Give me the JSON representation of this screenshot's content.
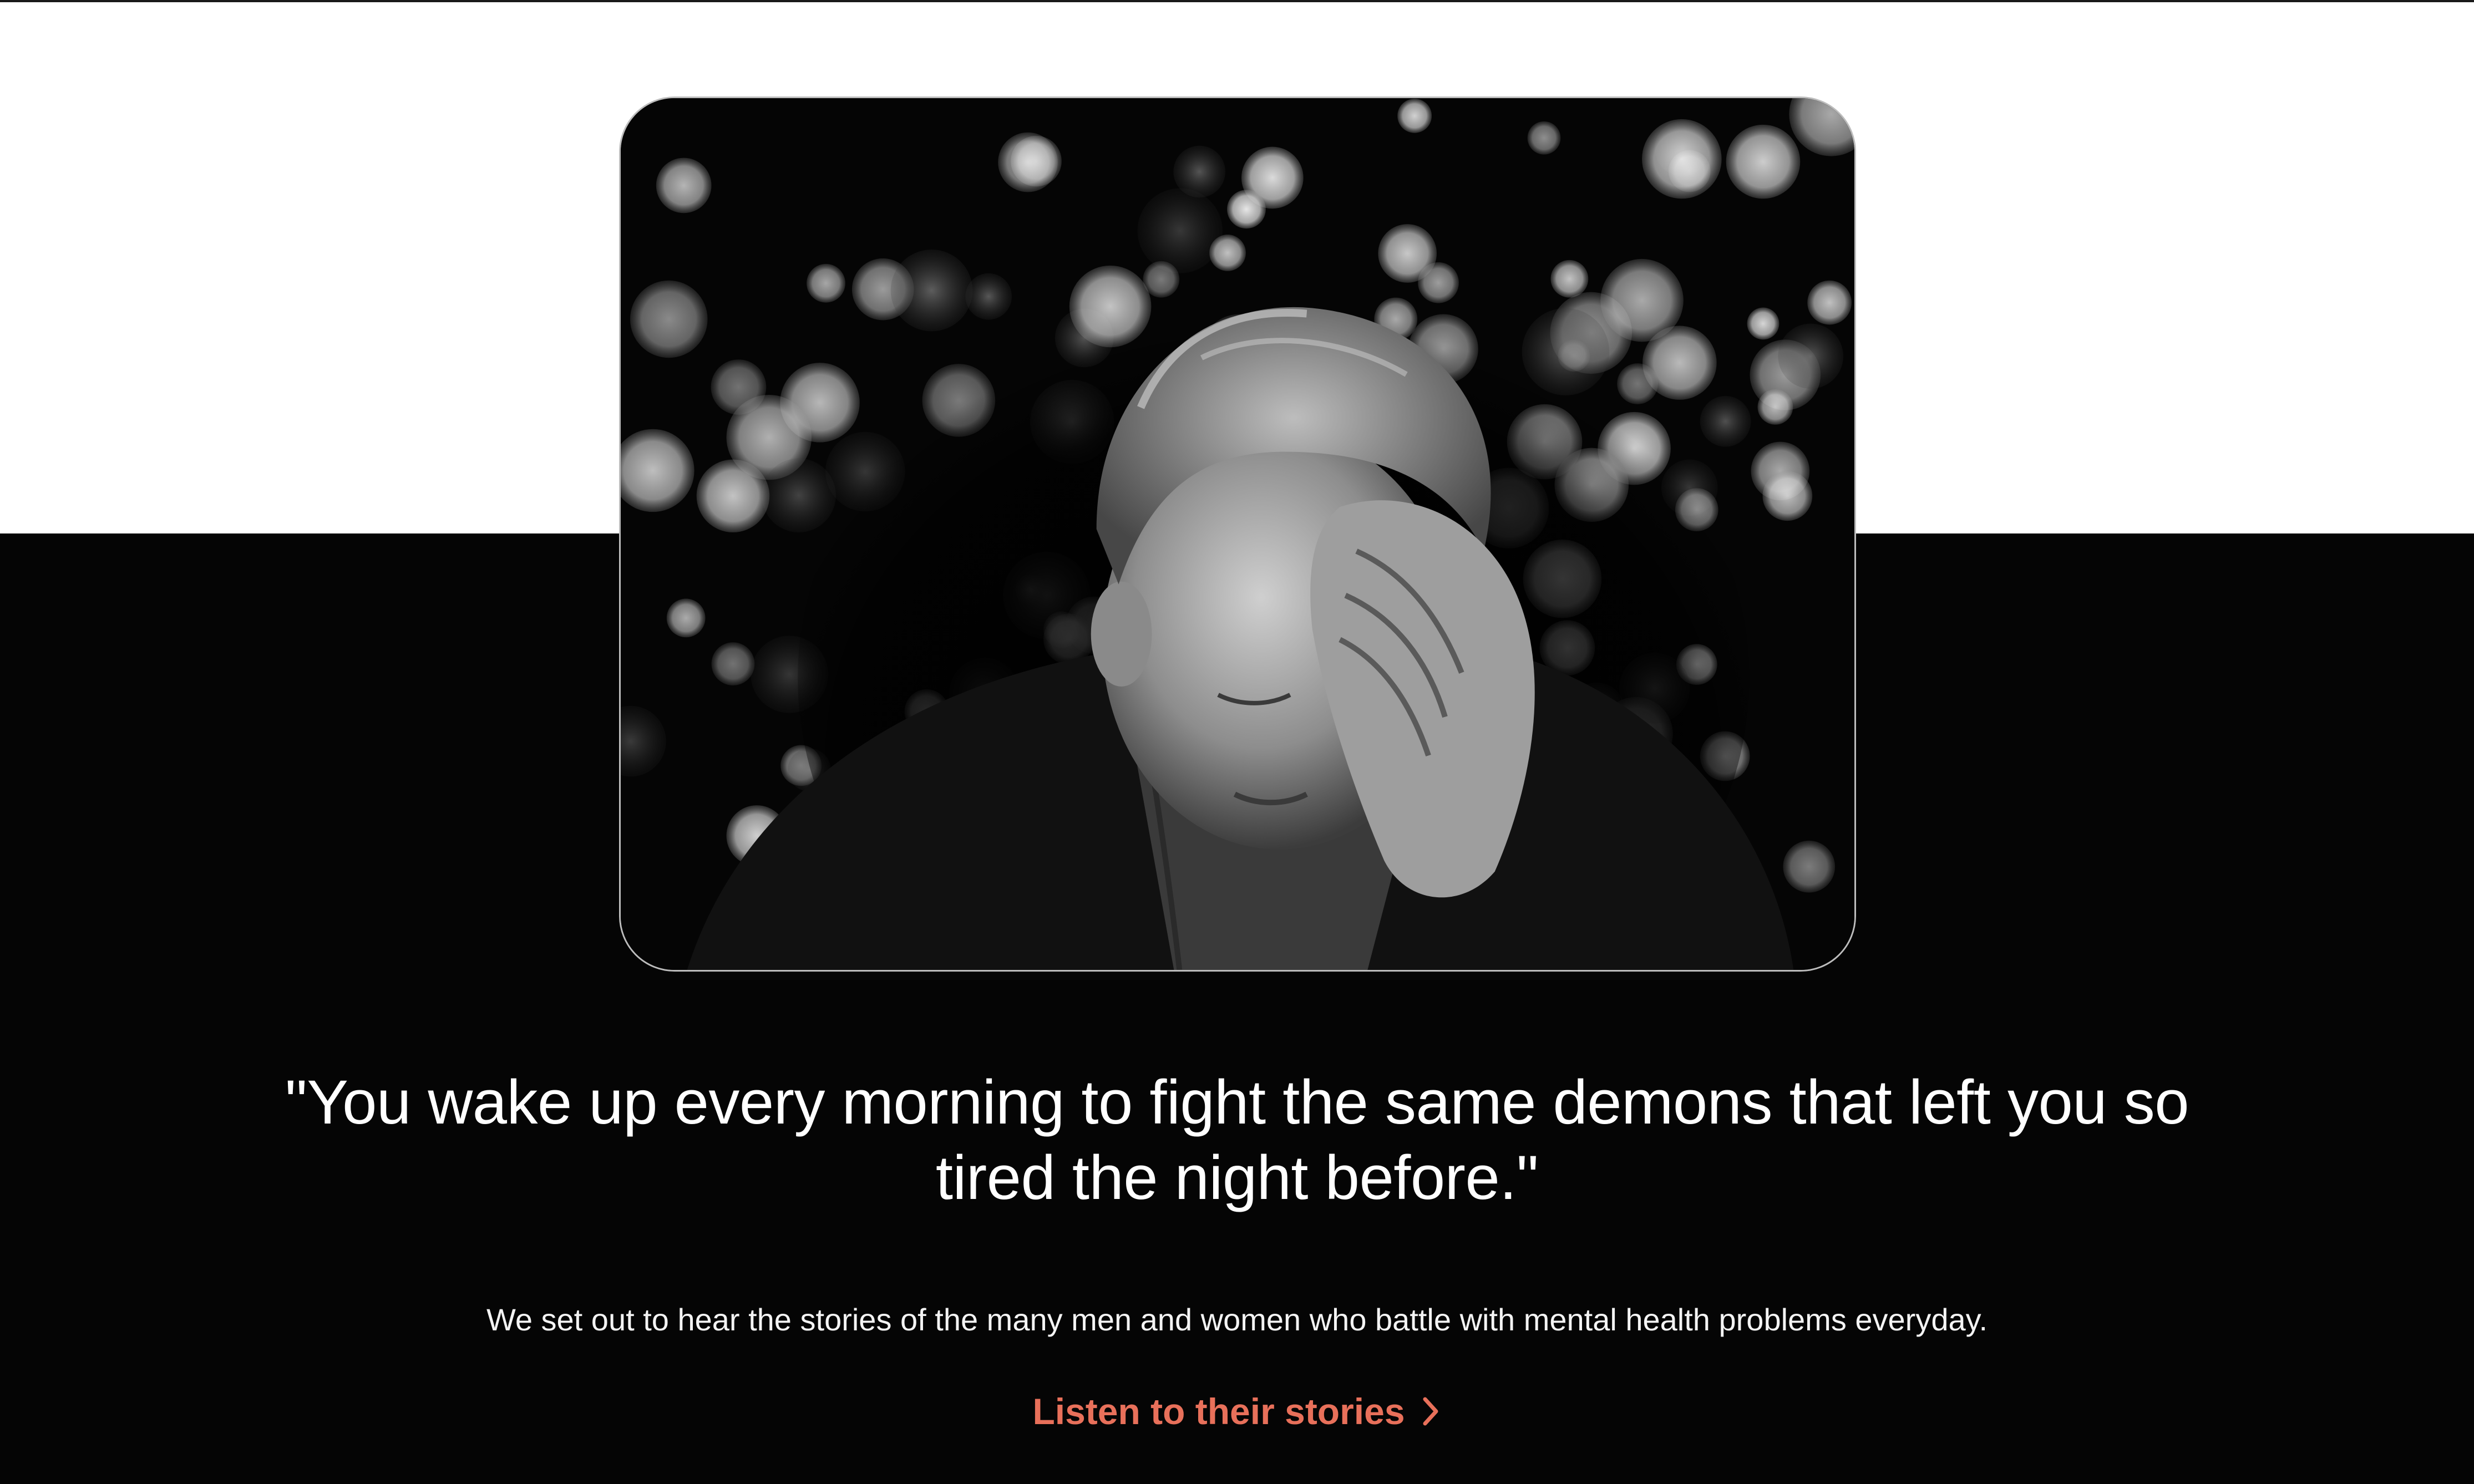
{
  "hero": {
    "quote": "\"You wake up every morning to fight the same demons that left you so tired the night before.\"",
    "subtitle": "We set out to hear the stories of the many men and women who battle with mental health problems everyday.",
    "cta_label": "Listen to their stories",
    "cta_icon": "chevron-right-icon",
    "image_subject": "photo of a distressed man holding his head, bokeh lights background"
  },
  "colors": {
    "top_background": "#ffffff",
    "bottom_background": "#050505",
    "text": "#ffffff",
    "accent": "#e8705a"
  }
}
